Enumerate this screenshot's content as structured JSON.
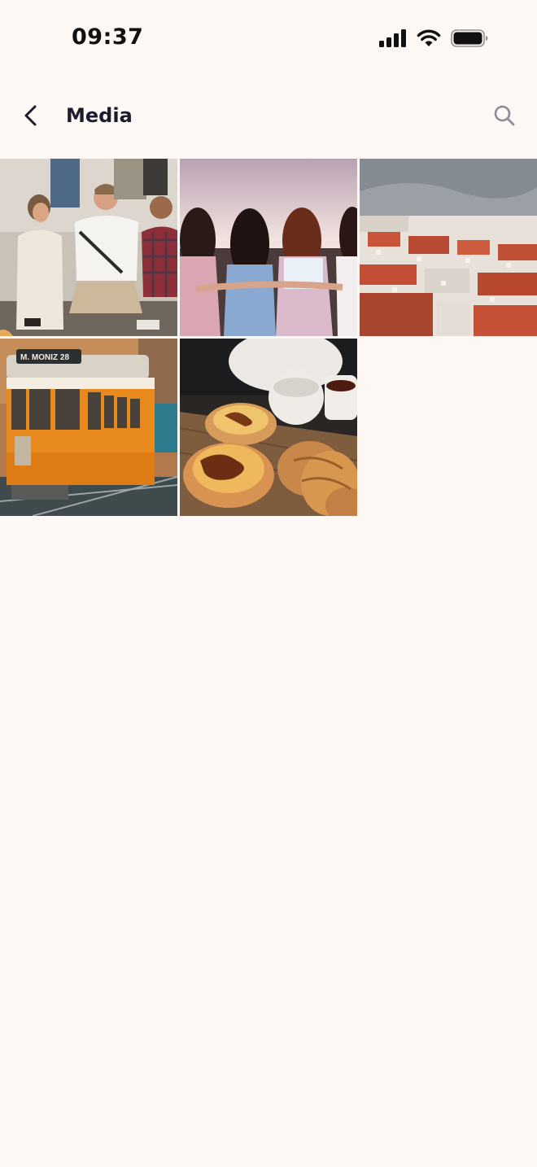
{
  "status_bar": {
    "time": "09:37",
    "icons": [
      "cellular-signal-icon",
      "wifi-icon",
      "battery-icon"
    ]
  },
  "header": {
    "back_icon": "chevron-left-icon",
    "title": "Media",
    "search_icon": "search-icon"
  },
  "media": {
    "items": [
      {
        "subject": "group-of-friends-sitting"
      },
      {
        "subject": "friends-at-sunset"
      },
      {
        "subject": "city-rooftops"
      },
      {
        "subject": "yellow-tram",
        "sign_text": "M. MONIZ 28"
      },
      {
        "subject": "custard-tarts-and-coffee"
      }
    ]
  },
  "colors": {
    "background": "#fdf8f3",
    "title": "#1f1b2e",
    "icon_gray": "#8e8a99"
  }
}
